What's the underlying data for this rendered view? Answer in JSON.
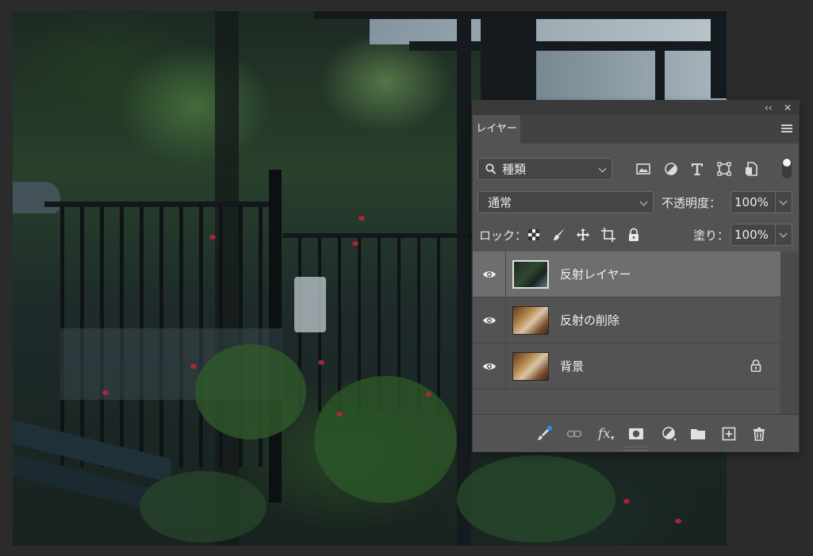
{
  "panel": {
    "collapse_icon": "double-chevron-left",
    "close_icon": "close-x",
    "tab_label": "レイヤー",
    "menu_icon": "hamburger-menu"
  },
  "filter": {
    "search_icon": "magnifier",
    "kind_label": "種類",
    "icons": [
      "image-filter-icon",
      "adjustment-filter-icon",
      "type-filter-icon",
      "shape-filter-icon",
      "smart-object-filter-icon"
    ],
    "toggle_state": "on"
  },
  "blend": {
    "mode": "通常",
    "opacity_label": "不透明度：",
    "opacity_value": "100%"
  },
  "lock": {
    "label": "ロック：",
    "icons": [
      "lock-transparent-pixels-icon",
      "lock-image-pixels-icon",
      "lock-position-icon",
      "lock-artboard-icon",
      "lock-all-icon"
    ],
    "fill_label": "塗り：",
    "fill_value": "100%"
  },
  "layers": [
    {
      "name": "反射レイヤー",
      "selected": true,
      "locked": false,
      "thumb": "dark-garden"
    },
    {
      "name": "反射の削除",
      "selected": false,
      "locked": false,
      "thumb": "shop-warm"
    },
    {
      "name": "背景",
      "selected": false,
      "locked": true,
      "thumb": "shop-warm"
    }
  ],
  "bottom_icons": [
    "layer-effects-brush-icon",
    "link-layers-icon",
    "fx",
    "add-mask-icon",
    "new-adjustment-layer-icon",
    "new-group-icon",
    "new-layer-icon",
    "delete-layer-icon"
  ],
  "colors": {
    "panel_bg": "#535353",
    "selected_row": "#6e6e6e",
    "arrow_teal": "#2fb5a8",
    "badge_blue": "#2d8ceb"
  }
}
